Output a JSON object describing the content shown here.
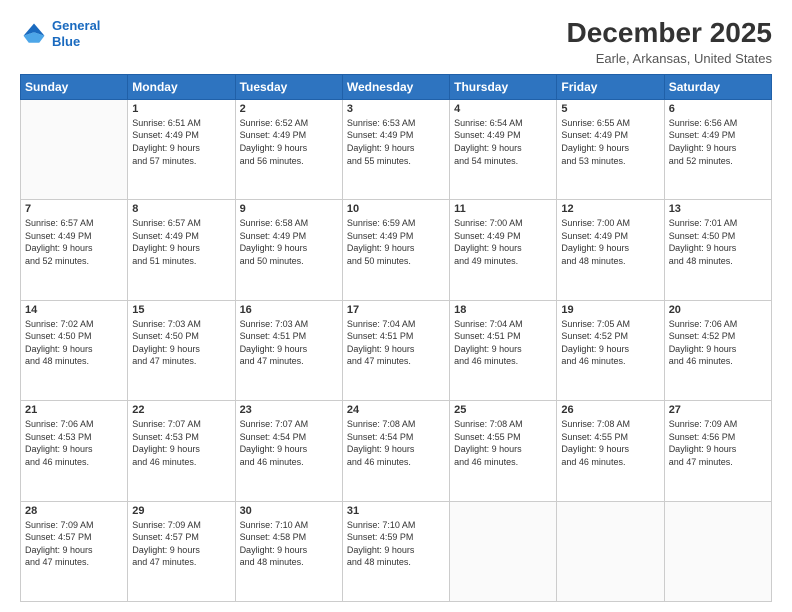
{
  "header": {
    "logo_line1": "General",
    "logo_line2": "Blue",
    "title": "December 2025",
    "subtitle": "Earle, Arkansas, United States"
  },
  "calendar": {
    "days_of_week": [
      "Sunday",
      "Monday",
      "Tuesday",
      "Wednesday",
      "Thursday",
      "Friday",
      "Saturday"
    ],
    "weeks": [
      [
        {
          "day": "",
          "info": ""
        },
        {
          "day": "1",
          "info": "Sunrise: 6:51 AM\nSunset: 4:49 PM\nDaylight: 9 hours\nand 57 minutes."
        },
        {
          "day": "2",
          "info": "Sunrise: 6:52 AM\nSunset: 4:49 PM\nDaylight: 9 hours\nand 56 minutes."
        },
        {
          "day": "3",
          "info": "Sunrise: 6:53 AM\nSunset: 4:49 PM\nDaylight: 9 hours\nand 55 minutes."
        },
        {
          "day": "4",
          "info": "Sunrise: 6:54 AM\nSunset: 4:49 PM\nDaylight: 9 hours\nand 54 minutes."
        },
        {
          "day": "5",
          "info": "Sunrise: 6:55 AM\nSunset: 4:49 PM\nDaylight: 9 hours\nand 53 minutes."
        },
        {
          "day": "6",
          "info": "Sunrise: 6:56 AM\nSunset: 4:49 PM\nDaylight: 9 hours\nand 52 minutes."
        }
      ],
      [
        {
          "day": "7",
          "info": "Sunrise: 6:57 AM\nSunset: 4:49 PM\nDaylight: 9 hours\nand 52 minutes."
        },
        {
          "day": "8",
          "info": "Sunrise: 6:57 AM\nSunset: 4:49 PM\nDaylight: 9 hours\nand 51 minutes."
        },
        {
          "day": "9",
          "info": "Sunrise: 6:58 AM\nSunset: 4:49 PM\nDaylight: 9 hours\nand 50 minutes."
        },
        {
          "day": "10",
          "info": "Sunrise: 6:59 AM\nSunset: 4:49 PM\nDaylight: 9 hours\nand 50 minutes."
        },
        {
          "day": "11",
          "info": "Sunrise: 7:00 AM\nSunset: 4:49 PM\nDaylight: 9 hours\nand 49 minutes."
        },
        {
          "day": "12",
          "info": "Sunrise: 7:00 AM\nSunset: 4:49 PM\nDaylight: 9 hours\nand 48 minutes."
        },
        {
          "day": "13",
          "info": "Sunrise: 7:01 AM\nSunset: 4:50 PM\nDaylight: 9 hours\nand 48 minutes."
        }
      ],
      [
        {
          "day": "14",
          "info": "Sunrise: 7:02 AM\nSunset: 4:50 PM\nDaylight: 9 hours\nand 48 minutes."
        },
        {
          "day": "15",
          "info": "Sunrise: 7:03 AM\nSunset: 4:50 PM\nDaylight: 9 hours\nand 47 minutes."
        },
        {
          "day": "16",
          "info": "Sunrise: 7:03 AM\nSunset: 4:51 PM\nDaylight: 9 hours\nand 47 minutes."
        },
        {
          "day": "17",
          "info": "Sunrise: 7:04 AM\nSunset: 4:51 PM\nDaylight: 9 hours\nand 47 minutes."
        },
        {
          "day": "18",
          "info": "Sunrise: 7:04 AM\nSunset: 4:51 PM\nDaylight: 9 hours\nand 46 minutes."
        },
        {
          "day": "19",
          "info": "Sunrise: 7:05 AM\nSunset: 4:52 PM\nDaylight: 9 hours\nand 46 minutes."
        },
        {
          "day": "20",
          "info": "Sunrise: 7:06 AM\nSunset: 4:52 PM\nDaylight: 9 hours\nand 46 minutes."
        }
      ],
      [
        {
          "day": "21",
          "info": "Sunrise: 7:06 AM\nSunset: 4:53 PM\nDaylight: 9 hours\nand 46 minutes."
        },
        {
          "day": "22",
          "info": "Sunrise: 7:07 AM\nSunset: 4:53 PM\nDaylight: 9 hours\nand 46 minutes."
        },
        {
          "day": "23",
          "info": "Sunrise: 7:07 AM\nSunset: 4:54 PM\nDaylight: 9 hours\nand 46 minutes."
        },
        {
          "day": "24",
          "info": "Sunrise: 7:08 AM\nSunset: 4:54 PM\nDaylight: 9 hours\nand 46 minutes."
        },
        {
          "day": "25",
          "info": "Sunrise: 7:08 AM\nSunset: 4:55 PM\nDaylight: 9 hours\nand 46 minutes."
        },
        {
          "day": "26",
          "info": "Sunrise: 7:08 AM\nSunset: 4:55 PM\nDaylight: 9 hours\nand 46 minutes."
        },
        {
          "day": "27",
          "info": "Sunrise: 7:09 AM\nSunset: 4:56 PM\nDaylight: 9 hours\nand 47 minutes."
        }
      ],
      [
        {
          "day": "28",
          "info": "Sunrise: 7:09 AM\nSunset: 4:57 PM\nDaylight: 9 hours\nand 47 minutes."
        },
        {
          "day": "29",
          "info": "Sunrise: 7:09 AM\nSunset: 4:57 PM\nDaylight: 9 hours\nand 47 minutes."
        },
        {
          "day": "30",
          "info": "Sunrise: 7:10 AM\nSunset: 4:58 PM\nDaylight: 9 hours\nand 48 minutes."
        },
        {
          "day": "31",
          "info": "Sunrise: 7:10 AM\nSunset: 4:59 PM\nDaylight: 9 hours\nand 48 minutes."
        },
        {
          "day": "",
          "info": ""
        },
        {
          "day": "",
          "info": ""
        },
        {
          "day": "",
          "info": ""
        }
      ]
    ]
  }
}
